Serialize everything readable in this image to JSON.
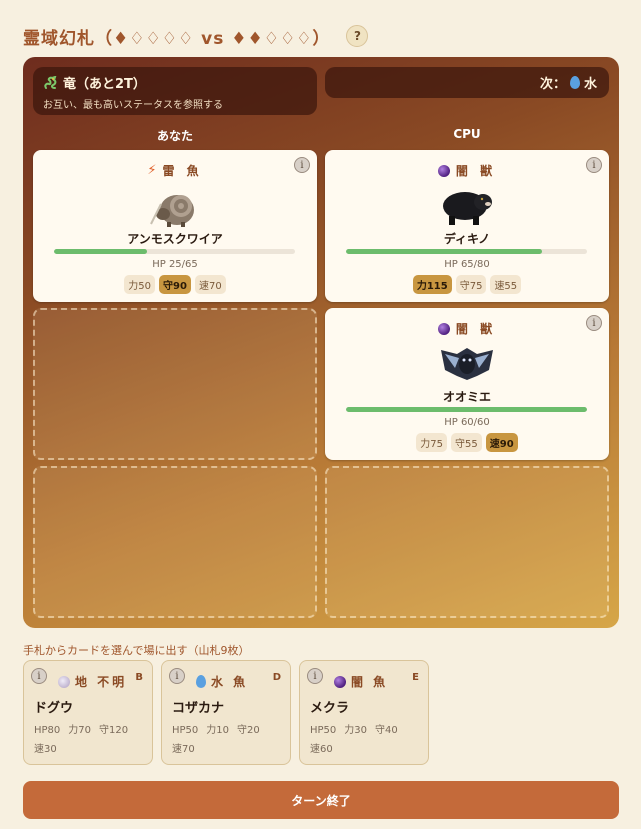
{
  "title": "霊域幻札（♦♢♢♢♢ vs ♦♦♢♢♢）",
  "help_label": "?",
  "field": {
    "name": "竜（あと2T）",
    "description": "お互い、最も高いステータスを参照する",
    "icon": "dragon-icon"
  },
  "next": {
    "label": "次：",
    "element": "水",
    "icon": "water-drop-icon"
  },
  "player_label": "あなた",
  "cpu_label": "CPU",
  "player_cards": [
    {
      "type": "雷 魚",
      "type_icon": "lightning-icon",
      "name": "アンモスクワイア",
      "hp_text": "HP 25/65",
      "hp_current": 25,
      "hp_max": 65,
      "stats": [
        {
          "label": "力50",
          "highlight": false
        },
        {
          "label": "守90",
          "highlight": true
        },
        {
          "label": "速70",
          "highlight": false
        }
      ]
    }
  ],
  "cpu_cards": [
    {
      "type": "闇 獣",
      "type_icon": "dark-orb-icon",
      "name": "ディキノ",
      "hp_text": "HP 65/80",
      "hp_current": 65,
      "hp_max": 80,
      "stats": [
        {
          "label": "力115",
          "highlight": true
        },
        {
          "label": "守75",
          "highlight": false
        },
        {
          "label": "速55",
          "highlight": false
        }
      ]
    },
    {
      "type": "闇 獣",
      "type_icon": "dark-orb-icon",
      "name": "オオミエ",
      "hp_text": "HP 60/60",
      "hp_current": 60,
      "hp_max": 60,
      "stats": [
        {
          "label": "力75",
          "highlight": false
        },
        {
          "label": "守55",
          "highlight": false
        },
        {
          "label": "速90",
          "highlight": true
        }
      ]
    }
  ],
  "hand_label": "手札からカードを選んで場に出す（山札9枚）",
  "hand": [
    {
      "type": "地 不明",
      "type_icon": "earth-orb-icon",
      "rank": "B",
      "name": "ドグウ",
      "hp": "HP80",
      "atk": "力70",
      "def": "守120",
      "spd": "速30"
    },
    {
      "type": "水 魚",
      "type_icon": "water-drop-icon",
      "rank": "D",
      "name": "コザカナ",
      "hp": "HP50",
      "atk": "力10",
      "def": "守20",
      "spd": "速70"
    },
    {
      "type": "闇 魚",
      "type_icon": "dark-orb-icon",
      "rank": "E",
      "name": "メクラ",
      "hp": "HP50",
      "atk": "力30",
      "def": "守40",
      "spd": "速60"
    }
  ],
  "end_turn_label": "ターン終了",
  "info_glyph": "i"
}
